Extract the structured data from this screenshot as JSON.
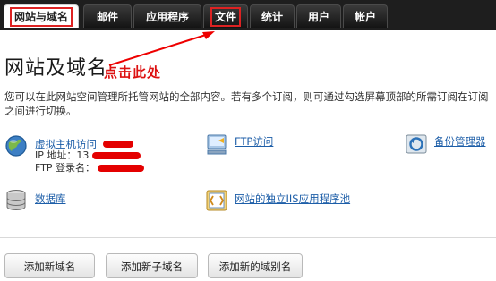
{
  "nav": {
    "tabs": [
      {
        "label": "网站与域名",
        "active": true
      },
      {
        "label": "邮件",
        "active": false
      },
      {
        "label": "应用程序",
        "active": false
      },
      {
        "label": "文件",
        "active": false,
        "highlighted": true
      },
      {
        "label": "统计",
        "active": false
      },
      {
        "label": "用户",
        "active": false
      },
      {
        "label": "帐户",
        "active": false
      }
    ]
  },
  "main": {
    "title": "网站及域名",
    "annotation": "点击此处",
    "description": "您可以在此网站空间管理所托管网站的全部内容。若有多个订阅，则可通过勾选屏幕顶部的所需订阅在订阅之间进行切换。"
  },
  "tools": {
    "hosting": {
      "label": "虚拟主机访问",
      "ip_label": "IP 地址：13",
      "ftp_label": "FTP 登录名："
    },
    "ftp": {
      "label": "FTP访问"
    },
    "backup": {
      "label": "备份管理器"
    },
    "database": {
      "label": "数据库"
    },
    "iis": {
      "label": "网站的独立IIS应用程序池"
    }
  },
  "buttons": {
    "add_domain": "添加新域名",
    "add_subdomain": "添加新子域名",
    "add_alias": "添加新的域别名"
  },
  "colors": {
    "accent_red": "#d11111",
    "link_blue": "#1d5ea8",
    "nav_bg": "#1e1e1e"
  }
}
